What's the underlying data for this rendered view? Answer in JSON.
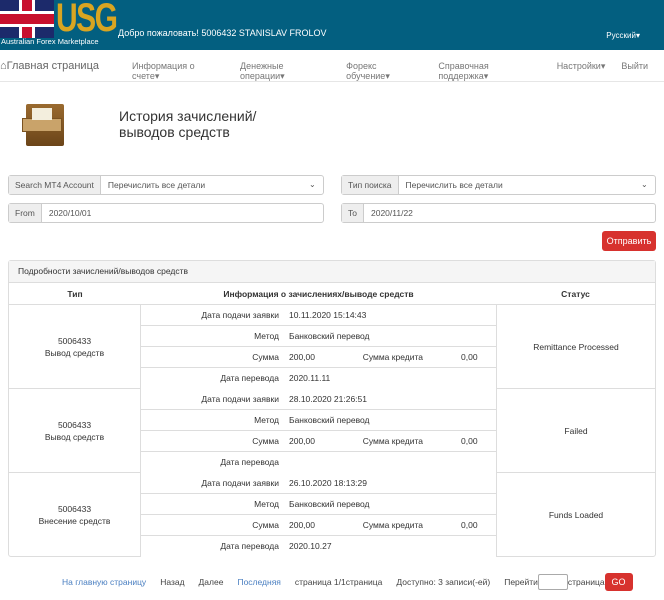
{
  "header": {
    "logo_text": "USG",
    "logo_sub": "Australian Forex Marketplace",
    "welcome": "Добро пожаловать! 5006432 STANISLAV FROLOV",
    "language": "Русский▾"
  },
  "nav": {
    "home": "Главная страница",
    "items": [
      "Информация о счете▾",
      "Денежные операции▾",
      "Форекс обучение▾",
      "Справочная поддержка▾",
      "Настройки▾",
      "Выйти"
    ]
  },
  "page": {
    "title_line1": "История зачислений/",
    "title_line2": "выводов средств"
  },
  "filters": {
    "account_label": "Search MT4 Account",
    "account_value": "Перечислить все детали",
    "type_label": "Тип поиска",
    "type_value": "Перечислить все детали",
    "from_label": "From",
    "from_value": "2020/10/01",
    "to_label": "To",
    "to_value": "2020/11/22",
    "submit": "Отправить"
  },
  "table": {
    "panel_title": "Подробности зачислений/выводов средств",
    "headers": [
      "Тип",
      "Информация о зачислениях/выводе средств",
      "Статус"
    ],
    "labels": {
      "date": "Дата подачи заявки",
      "method": "Метод",
      "amount": "Сумма",
      "credit": "Сумма кредита",
      "transfer": "Дата перевода"
    },
    "rows": [
      {
        "account": "5006433",
        "type": "Вывод средств",
        "date": "10.11.2020 15:14:43",
        "method": "Банковский перевод",
        "amount": "200,00",
        "credit": "0,00",
        "transfer": "2020.11.11",
        "status": "Remittance Processed"
      },
      {
        "account": "5006433",
        "type": "Вывод средств",
        "date": "28.10.2020 21:26:51",
        "method": "Банковский перевод",
        "amount": "200,00",
        "credit": "0,00",
        "transfer": "",
        "status": "Failed"
      },
      {
        "account": "5006433",
        "type": "Внесение средств",
        "date": "26.10.2020 18:13:29",
        "method": "Банковский перевод",
        "amount": "200,00",
        "credit": "0,00",
        "transfer": "2020.10.27",
        "status": "Funds Loaded"
      }
    ]
  },
  "pager": {
    "first": "На главную страницу",
    "prev": "Назад",
    "next": "Далее",
    "last": "Последняя",
    "page": "страница 1/1страница",
    "available": "Доступно: 3 записи(-ей)",
    "goto": "Перейти",
    "page_suffix": "страница",
    "go": "GO"
  }
}
